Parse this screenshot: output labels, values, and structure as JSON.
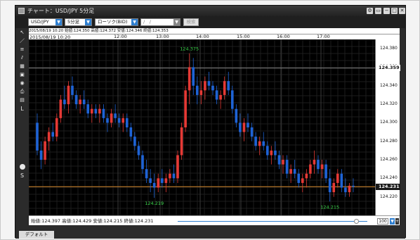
{
  "window": {
    "title": "チャート：USD/JPY 5分足",
    "controls": [
      "gear-icon",
      "window-icon",
      "minimize-icon",
      "maximize-icon",
      "close-icon"
    ]
  },
  "toolbar": {
    "pair": "USD/JPY",
    "interval": "5分足",
    "chart_type": "ローソク(BID)",
    "date_placeholder": "/　/",
    "search_label": "検索"
  },
  "info": {
    "datetime": "2015/08/19 10:20",
    "open": "始値:124.350",
    "high": "高値:124.372",
    "low": "安値:124.346",
    "close": "終値:124.353"
  },
  "time_axis": {
    "cursor_time": "2015/08/19 10:20",
    "labels": [
      "12:00",
      "13:00",
      "14:00",
      "15:00",
      "16:00",
      "17:00"
    ]
  },
  "price_axis": {
    "ticks": [
      "124.380",
      "124.360",
      "124.340",
      "124.320",
      "124.300",
      "124.280",
      "124.260",
      "124.240",
      "124.220"
    ],
    "cursor_price": "124.359",
    "current_price": "124.231"
  },
  "annotations": {
    "high_label": "124.375",
    "low_label_1": "124.219",
    "low_label_2": "124.215"
  },
  "summary": {
    "open": "始値:124.397",
    "high": "高値:124.429",
    "low": "安値:124.215",
    "close": "終値:124.231",
    "zoom": "100"
  },
  "tabs": [
    "デフォルト"
  ],
  "left_tools": [
    "cursor-icon",
    "line-icon",
    "fibonacci-icon",
    "channel-icon",
    "grid-icon",
    "layout-icon",
    "eye-icon",
    "print-icon",
    "save-icon",
    "label-icon"
  ],
  "left_tool_letters": {
    "l": "L",
    "s": "S"
  },
  "colors": {
    "bull": "#e53935",
    "bear": "#1e63d6",
    "annotation": "#3ad64a",
    "current_line": "#d98a2b",
    "cursor_price_bg": "#ffffff",
    "current_price_bg": "#1a1a1a"
  },
  "chart_data": {
    "type": "candlestick",
    "ylim": [
      124.2,
      124.39
    ],
    "x_ticks": [
      "12:00",
      "13:00",
      "14:00",
      "15:00",
      "16:00",
      "17:00"
    ],
    "candles": [
      [
        124.3,
        124.31,
        124.265,
        124.27
      ],
      [
        124.27,
        124.28,
        124.25,
        124.26
      ],
      [
        124.26,
        124.285,
        124.255,
        124.28
      ],
      [
        124.28,
        124.295,
        124.27,
        124.29
      ],
      [
        124.29,
        124.3,
        124.28,
        124.285
      ],
      [
        124.285,
        124.31,
        124.28,
        124.305
      ],
      [
        124.305,
        124.33,
        124.3,
        124.325
      ],
      [
        124.325,
        124.34,
        124.315,
        124.32
      ],
      [
        124.32,
        124.345,
        124.31,
        124.34
      ],
      [
        124.34,
        124.35,
        124.325,
        124.33
      ],
      [
        124.33,
        124.335,
        124.315,
        124.32
      ],
      [
        124.32,
        124.33,
        124.31,
        124.325
      ],
      [
        124.325,
        124.335,
        124.315,
        124.32
      ],
      [
        124.32,
        124.325,
        124.305,
        124.31
      ],
      [
        124.31,
        124.32,
        124.3,
        124.315
      ],
      [
        124.315,
        124.32,
        124.305,
        124.31
      ],
      [
        124.31,
        124.32,
        124.3,
        124.315
      ],
      [
        124.315,
        124.32,
        124.3,
        124.305
      ],
      [
        124.305,
        124.31,
        124.29,
        124.3
      ],
      [
        124.3,
        124.315,
        124.295,
        124.31
      ],
      [
        124.31,
        124.32,
        124.3,
        124.305
      ],
      [
        124.305,
        124.31,
        124.295,
        124.3
      ],
      [
        124.3,
        124.31,
        124.29,
        124.305
      ],
      [
        124.305,
        124.31,
        124.29,
        124.295
      ],
      [
        124.295,
        124.3,
        124.28,
        124.285
      ],
      [
        124.285,
        124.29,
        124.27,
        124.275
      ],
      [
        124.275,
        124.28,
        124.26,
        124.265
      ],
      [
        124.265,
        124.27,
        124.245,
        124.25
      ],
      [
        124.25,
        124.26,
        124.235,
        124.24
      ],
      [
        124.24,
        124.25,
        124.225,
        124.235
      ],
      [
        124.235,
        124.245,
        124.219,
        124.23
      ],
      [
        124.23,
        124.245,
        124.225,
        124.24
      ],
      [
        124.24,
        124.25,
        124.23,
        124.235
      ],
      [
        124.235,
        124.245,
        124.225,
        124.24
      ],
      [
        124.24,
        124.25,
        124.235,
        124.245
      ],
      [
        124.245,
        124.255,
        124.235,
        124.24
      ],
      [
        124.24,
        124.27,
        124.235,
        124.265
      ],
      [
        124.265,
        124.3,
        124.26,
        124.295
      ],
      [
        124.295,
        124.34,
        124.29,
        124.335
      ],
      [
        124.335,
        124.375,
        124.32,
        124.36
      ],
      [
        124.36,
        124.37,
        124.33,
        124.34
      ],
      [
        124.34,
        124.35,
        124.32,
        124.33
      ],
      [
        124.33,
        124.345,
        124.32,
        124.335
      ],
      [
        124.335,
        124.35,
        124.325,
        124.345
      ],
      [
        124.345,
        124.355,
        124.335,
        124.34
      ],
      [
        124.34,
        124.345,
        124.33,
        124.335
      ],
      [
        124.335,
        124.34,
        124.32,
        124.325
      ],
      [
        124.325,
        124.335,
        124.315,
        124.33
      ],
      [
        124.33,
        124.35,
        124.325,
        124.345
      ],
      [
        124.345,
        124.355,
        124.33,
        124.335
      ],
      [
        124.335,
        124.34,
        124.31,
        124.315
      ],
      [
        124.315,
        124.32,
        124.295,
        124.3
      ],
      [
        124.3,
        124.31,
        124.285,
        124.29
      ],
      [
        124.29,
        124.305,
        124.28,
        124.3
      ],
      [
        124.3,
        124.31,
        124.29,
        124.295
      ],
      [
        124.295,
        124.3,
        124.28,
        124.285
      ],
      [
        124.285,
        124.29,
        124.27,
        124.275
      ],
      [
        124.275,
        124.285,
        124.265,
        124.28
      ],
      [
        124.28,
        124.29,
        124.27,
        124.275
      ],
      [
        124.275,
        124.28,
        124.26,
        124.265
      ],
      [
        124.265,
        124.275,
        124.255,
        124.27
      ],
      [
        124.27,
        124.28,
        124.26,
        124.265
      ],
      [
        124.265,
        124.27,
        124.25,
        124.255
      ],
      [
        124.255,
        124.265,
        124.245,
        124.26
      ],
      [
        124.26,
        124.265,
        124.24,
        124.245
      ],
      [
        124.245,
        124.255,
        124.235,
        124.25
      ],
      [
        124.25,
        124.26,
        124.24,
        124.245
      ],
      [
        124.245,
        124.25,
        124.23,
        124.235
      ],
      [
        124.235,
        124.245,
        124.225,
        124.24
      ],
      [
        124.24,
        124.25,
        124.23,
        124.245
      ],
      [
        124.245,
        124.26,
        124.24,
        124.255
      ],
      [
        124.255,
        124.27,
        124.245,
        124.26
      ],
      [
        124.26,
        124.265,
        124.245,
        124.25
      ],
      [
        124.25,
        124.26,
        124.24,
        124.255
      ],
      [
        124.255,
        124.26,
        124.235,
        124.24
      ],
      [
        124.24,
        124.25,
        124.215,
        124.225
      ],
      [
        124.225,
        124.24,
        124.22,
        124.235
      ],
      [
        124.235,
        124.25,
        124.23,
        124.245
      ],
      [
        124.245,
        124.25,
        124.225,
        124.23
      ],
      [
        124.23,
        124.24,
        124.22,
        124.225
      ],
      [
        124.225,
        124.235,
        124.22,
        124.232
      ],
      [
        124.232,
        124.24,
        124.225,
        124.231
      ]
    ]
  }
}
